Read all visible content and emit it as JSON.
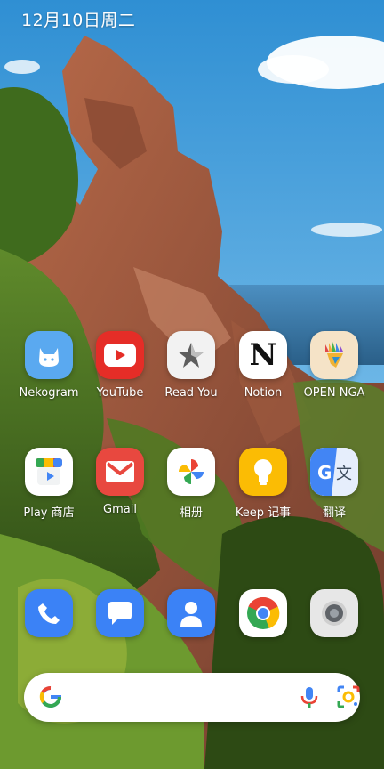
{
  "status": {
    "date": "12月10日周二"
  },
  "home": {
    "row1": [
      {
        "name": "Nekogram",
        "icon": "cat-icon"
      },
      {
        "name": "YouTube",
        "icon": "youtube-icon"
      },
      {
        "name": "Read You",
        "icon": "star-icon"
      },
      {
        "name": "Notion",
        "icon": "notion-icon"
      },
      {
        "name": "OPEN NGA",
        "icon": "nga-icon"
      }
    ],
    "row2": [
      {
        "name": "Play 商店",
        "icon": "play-store-icon"
      },
      {
        "name": "Gmail",
        "icon": "mail-icon"
      },
      {
        "name": "相册",
        "icon": "photos-icon"
      },
      {
        "name": "Keep 记事",
        "icon": "keep-bulb-icon"
      },
      {
        "name": "翻译",
        "icon": "translate-icon"
      }
    ],
    "dock": [
      {
        "icon": "phone-icon"
      },
      {
        "icon": "messages-icon"
      },
      {
        "icon": "contacts-icon"
      },
      {
        "icon": "chrome-icon"
      },
      {
        "icon": "camera-icon"
      }
    ]
  },
  "search": {
    "placeholder": ""
  },
  "colors": {
    "youtube": "#e52d27",
    "keep": "#fbbc04",
    "accent_blue": "#3b82f6"
  }
}
